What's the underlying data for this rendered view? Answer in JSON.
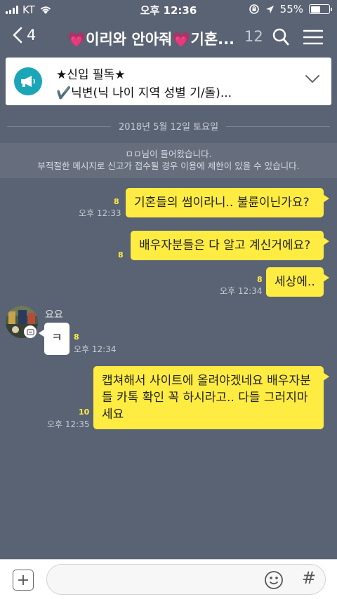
{
  "status_bar": {
    "carrier": "KT",
    "time": "오후 12:36",
    "battery": "55%",
    "battery_level": 0.55
  },
  "nav": {
    "back_count": "4",
    "title": "💗이리와 안아줘💗기혼...",
    "member_count": "12"
  },
  "notice": {
    "line1": "★신입 필독★",
    "line2": "✔️닉변(닉 나이 지역 성별 기/돌)..."
  },
  "date_divider": "2018년 5월 12일 토요일",
  "system_message": {
    "line1": "ㅁㅁ님이 들어왔습니다.",
    "line2": "부적절한 메시지로 신고가 접수될 경우 이용에 제한이 있을 수 있습니다."
  },
  "messages": [
    {
      "side": "right",
      "text": "기혼들의 썸이라니.. 불륜이닌가요?",
      "unread": "8",
      "time": "오후 12:33"
    },
    {
      "side": "right",
      "text": "배우자분들은 다 알고 계신거에요?",
      "unread": "8",
      "time": ""
    },
    {
      "side": "right",
      "text": "세상에..",
      "unread": "8",
      "time": "오후 12:34"
    },
    {
      "side": "left",
      "sender": "요요",
      "text": "ㅋ",
      "unread": "8",
      "time": "오후 12:34"
    },
    {
      "side": "right",
      "text": "캡쳐해서 사이트에 올려야겠네요 배우자분들 카톡 확인 꼭 하시라고.. 다들 그러지마세요",
      "unread": "10",
      "time": "오후 12:35"
    }
  ],
  "input": {
    "placeholder": "",
    "hash": "#"
  },
  "colors": {
    "background": "#5a6373",
    "bubble_mine": "#ffec42",
    "bubble_other": "#ffffff",
    "unread": "#ffec42",
    "notice_icon": "#1aa6b7"
  },
  "icons": [
    "signal-icon",
    "wifi-icon",
    "orientation-lock-icon",
    "location-icon",
    "battery-icon",
    "back-chevron-icon",
    "search-icon",
    "menu-icon",
    "megaphone-icon",
    "chevron-down-icon",
    "plus-icon",
    "emoji-icon"
  ]
}
